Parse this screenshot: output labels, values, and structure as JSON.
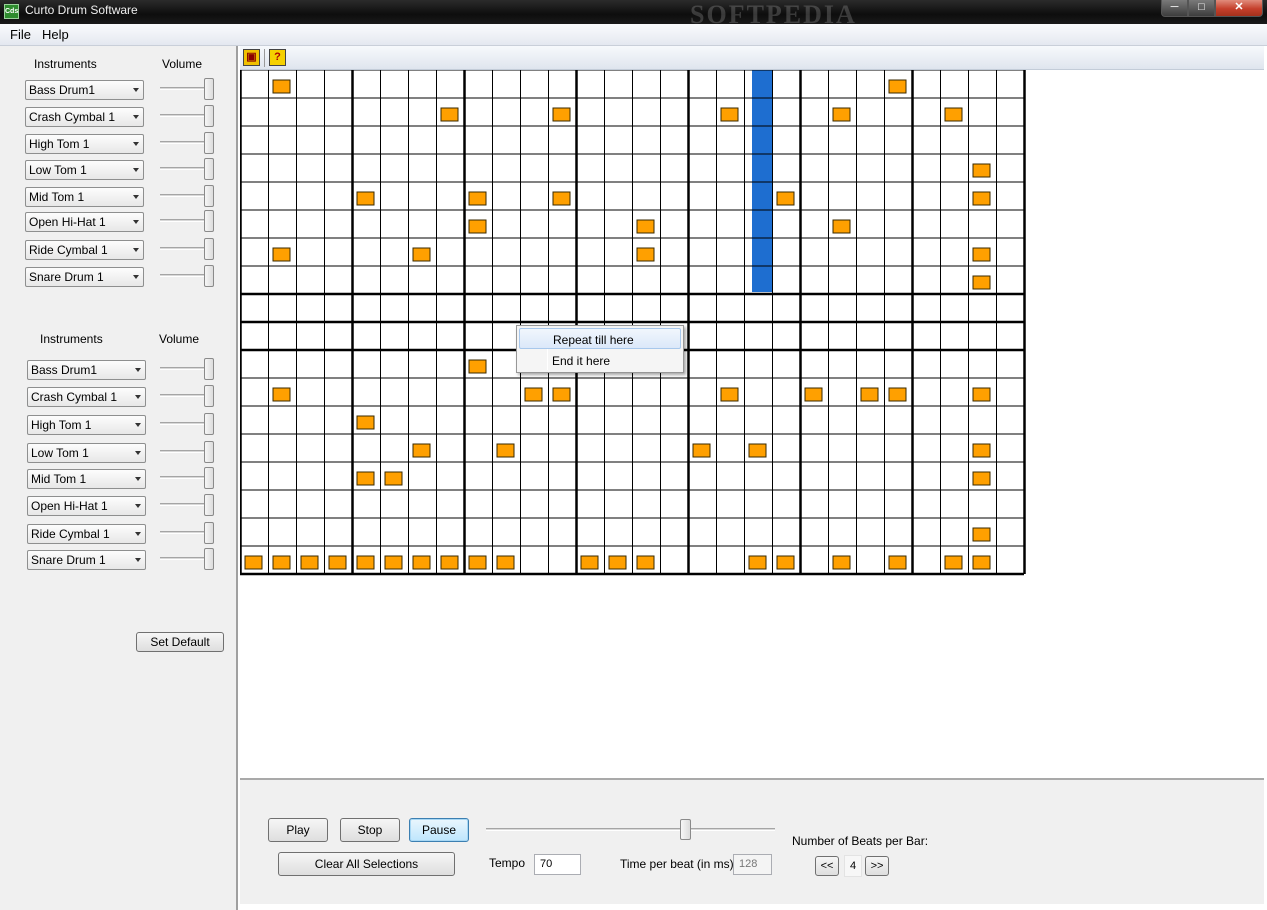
{
  "window": {
    "title": "Curto Drum Software",
    "icon_text": "Cds",
    "watermark": "SOFTPEDIA",
    "min_label": "─",
    "max_label": "□",
    "close_label": "✕"
  },
  "menu": {
    "file": "File",
    "help": "Help"
  },
  "toolbar": {
    "save_icon": "save-icon",
    "help_icon": "help-icon",
    "help_glyph": "?",
    "save_glyph": "▣"
  },
  "left_panel": {
    "group1": {
      "instruments_header": "Instruments",
      "volume_header": "Volume",
      "instruments": [
        "Bass Drum1",
        "Crash Cymbal 1",
        "High Tom 1",
        "Low Tom 1",
        "Mid Tom 1",
        "Open Hi-Hat 1",
        "Ride Cymbal 1",
        "Snare Drum 1"
      ]
    },
    "group2": {
      "instruments_header": "Instruments",
      "volume_header": "Volume",
      "instruments": [
        "Bass Drum1",
        "Crash Cymbal 1",
        "High Tom 1",
        "Low Tom 1",
        "Mid Tom 1",
        "Open Hi-Hat 1",
        "Ride Cymbal 1",
        "Snare Drum 1"
      ]
    },
    "set_default": "Set Default"
  },
  "grid": {
    "columns": 28,
    "beats_per_bar": 4,
    "playhead_column": 18,
    "group1_hits": [
      [
        1,
        23
      ],
      [
        7,
        11,
        17,
        21,
        25
      ],
      [],
      [
        26
      ],
      [
        4,
        8,
        11,
        19,
        26
      ],
      [
        8,
        14,
        21
      ],
      [
        1,
        6,
        14,
        26
      ],
      [
        26
      ]
    ],
    "group2_hits": [
      [
        8
      ],
      [
        1,
        10,
        11,
        17,
        20,
        22,
        23,
        26
      ],
      [
        4
      ],
      [
        6,
        9,
        16,
        18,
        26
      ],
      [
        4,
        5,
        26
      ],
      [],
      [
        26
      ],
      [
        0,
        1,
        2,
        3,
        4,
        5,
        6,
        7,
        8,
        9,
        12,
        13,
        14,
        18,
        19,
        21,
        23,
        25,
        26
      ]
    ],
    "hit_color": "#ffa000",
    "playhead_color": "#1e6ed0"
  },
  "context_menu": {
    "repeat": "Repeat till here",
    "end": "End it here"
  },
  "controls": {
    "play": "Play",
    "stop": "Stop",
    "pause": "Pause",
    "clear": "Clear All Selections",
    "tempo_label": "Tempo",
    "tempo_value": "70",
    "tpb_label": "Time per beat  (in ms)",
    "tpb_value": "128",
    "beats_label": "Number of Beats per Bar:",
    "prev": "<<",
    "next": ">>",
    "beats_value": "4"
  }
}
